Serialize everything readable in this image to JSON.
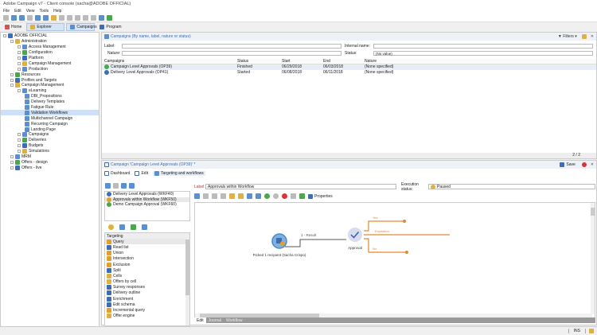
{
  "window": {
    "title": "Adobe Campaign v7 - Client console (sacha@ADOBE OFFICIAL)"
  },
  "menu": [
    "File",
    "Edit",
    "View",
    "Tools",
    "Help"
  ],
  "navtabs": {
    "home": "Home",
    "explorer": "Explorer",
    "campaigns": "Campaigns",
    "program": "Program"
  },
  "tree": [
    {
      "label": "ADOBE OFFICIAL",
      "level": 0
    },
    {
      "label": "Administration",
      "level": 1
    },
    {
      "label": "Access Management",
      "level": 2
    },
    {
      "label": "Configuration",
      "level": 2
    },
    {
      "label": "Platform",
      "level": 2
    },
    {
      "label": "Campaign Management",
      "level": 2
    },
    {
      "label": "Production",
      "level": 2
    },
    {
      "label": "Resources",
      "level": 1
    },
    {
      "label": "Profiles and Targets",
      "level": 1
    },
    {
      "label": "Campaign Management",
      "level": 1
    },
    {
      "label": "eLearning",
      "level": 2
    },
    {
      "label": "DBI_Propositions",
      "level": 3
    },
    {
      "label": "Delivery Templates",
      "level": 3
    },
    {
      "label": "Fatigue Rule",
      "level": 3
    },
    {
      "label": "Validation Workflows",
      "level": 3,
      "selected": true
    },
    {
      "label": "Multichannel Campaign",
      "level": 3
    },
    {
      "label": "Recurring Campaign",
      "level": 3
    },
    {
      "label": "Landing Page",
      "level": 3
    },
    {
      "label": "Campaigns",
      "level": 2
    },
    {
      "label": "Deliveries",
      "level": 2
    },
    {
      "label": "Budgets",
      "level": 2
    },
    {
      "label": "Simulations",
      "level": 2
    },
    {
      "label": "MRM",
      "level": 1
    },
    {
      "label": "Offers - design",
      "level": 1
    },
    {
      "label": "Offers - live",
      "level": 1
    }
  ],
  "campaigns_panel": {
    "title": "Campaigns (By name, label, nature or status)",
    "filters_label": "Filters",
    "label_field": "Label:",
    "internal_name_field": "Internal name:",
    "nature_field": "Nature:",
    "status_field": "Status:",
    "status_value": "(No value)",
    "columns": [
      "Campaigns",
      "Status",
      "Start",
      "End",
      "Nature"
    ],
    "rows": [
      {
        "name": "Campaign Level Approvals (OP39)",
        "status": "Finished",
        "start": "06/29/2018",
        "end": "06/03/2018",
        "nature": "(None specified)",
        "color": "#4aa84a"
      },
      {
        "name": "Delivery Level Approvals (OP41)",
        "status": "Started",
        "start": "06/08/2018",
        "end": "06/11/2018",
        "nature": "(None specified)",
        "color": "#3d6eb5"
      }
    ],
    "count": "2 / 2"
  },
  "detail": {
    "title": "Campaign 'Campaign Level Approvals (OP39)' *",
    "save": "Save",
    "tabs": [
      "Dashboard",
      "Edit",
      "Targeting and workflows"
    ],
    "workflows": [
      {
        "label": "Delivery Level Approvals (WKF40)",
        "color": "#3d6eb5"
      },
      {
        "label": "Approvals within Workflow (WKF50)",
        "color": "#e0a030"
      },
      {
        "label": "Demo Campaign Approval (WKF60)",
        "color": "#4aa84a"
      }
    ],
    "wf_label_caption": "Label:",
    "wf_label_value": "Approvals within Workflow",
    "exec_status_caption": "Execution status:",
    "exec_status_value": "Paused",
    "properties": "Properties",
    "palette_header": "Targeting",
    "palette": [
      "Query",
      "Read list",
      "Union",
      "Intersection",
      "Exclusion",
      "Split",
      "Cells",
      "Offers by cell",
      "Survey responses",
      "Delivery outline",
      "Enrichment",
      "Edit schema",
      "Incremental query",
      "Offer engine"
    ],
    "canvas": {
      "node1": "Picked 1 recipient (Sacha Crispo)",
      "transition1": "1 - Result",
      "node2": "Approval",
      "out_yes": "Yes",
      "out_exp": "Expiration",
      "out_no": "No"
    },
    "bottom_tabs": [
      "Edit",
      "Journal",
      "Workflow"
    ]
  },
  "status": {
    "mode": "INS"
  }
}
